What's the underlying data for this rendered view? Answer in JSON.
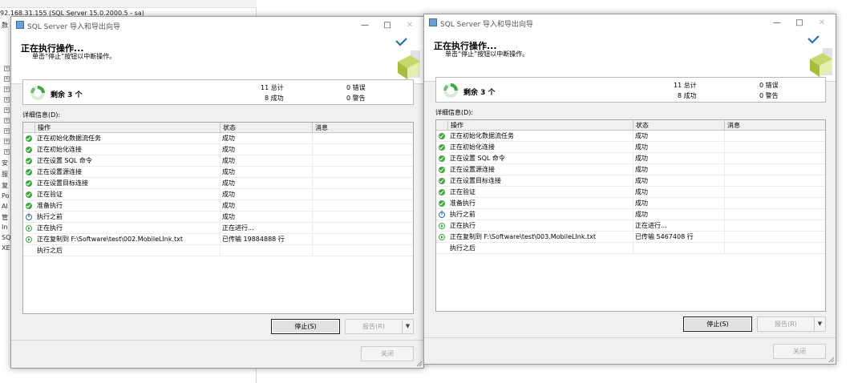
{
  "background": {
    "connection_text": "92.168.31.155 (SQL Server 15.0.2000.5 - sa)",
    "tree_labels": [
      "数",
      "安",
      "服",
      "复",
      "Po",
      "Al",
      "管",
      "In",
      "SQ",
      "XE"
    ]
  },
  "dialogs": [
    {
      "title": "SQL Server 导入和导出向导",
      "header_title": "正在执行操作...",
      "header_subtitle": "单击“停止”按钮以中断操作。",
      "remaining": "剩余 3 个",
      "stats": {
        "total": "11 总计",
        "success": "8 成功",
        "errors": "0 错误",
        "warnings": "0 警告"
      },
      "details_label": "详细信息(D):",
      "columns": {
        "action": "操作",
        "status": "状态",
        "message": "消息"
      },
      "rows": [
        {
          "icon": "ok",
          "action": "正在初始化数据流任务",
          "status": "成功"
        },
        {
          "icon": "ok",
          "action": "正在初始化连接",
          "status": "成功"
        },
        {
          "icon": "ok",
          "action": "正在设置 SQL 命令",
          "status": "成功"
        },
        {
          "icon": "ok",
          "action": "正在设置源连接",
          "status": "成功"
        },
        {
          "icon": "ok",
          "action": "正在设置目标连接",
          "status": "成功"
        },
        {
          "icon": "ok",
          "action": "正在验证",
          "status": "成功"
        },
        {
          "icon": "ok",
          "action": "准备执行",
          "status": "成功"
        },
        {
          "icon": "info",
          "action": "执行之前",
          "status": "成功"
        },
        {
          "icon": "run",
          "action": "正在执行",
          "status": "正在进行..."
        },
        {
          "icon": "run",
          "action": "正在复制到 F:\\Software\\test\\002.MobileLInk.txt",
          "status": "已传输 19884888 行"
        },
        {
          "icon": "",
          "action": "执行之后",
          "status": ""
        }
      ],
      "stop_label": "停止(S)",
      "report_label": "报告(R)",
      "close_label": "关闭"
    },
    {
      "title": "SQL Server 导入和导出向导",
      "header_title": "正在执行操作...",
      "header_subtitle": "单击“停止”按钮以中断操作。",
      "remaining": "剩余 3 个",
      "stats": {
        "total": "11 总计",
        "success": "8 成功",
        "errors": "0 错误",
        "warnings": "0 警告"
      },
      "details_label": "详细信息(D):",
      "columns": {
        "action": "操作",
        "status": "状态",
        "message": "消息"
      },
      "rows": [
        {
          "icon": "ok",
          "action": "正在初始化数据流任务",
          "status": "成功"
        },
        {
          "icon": "ok",
          "action": "正在初始化连接",
          "status": "成功"
        },
        {
          "icon": "ok",
          "action": "正在设置 SQL 命令",
          "status": "成功"
        },
        {
          "icon": "ok",
          "action": "正在设置源连接",
          "status": "成功"
        },
        {
          "icon": "ok",
          "action": "正在设置目标连接",
          "status": "成功"
        },
        {
          "icon": "ok",
          "action": "正在验证",
          "status": "成功"
        },
        {
          "icon": "ok",
          "action": "准备执行",
          "status": "成功"
        },
        {
          "icon": "info",
          "action": "执行之前",
          "status": "成功"
        },
        {
          "icon": "run",
          "action": "正在执行",
          "status": "正在进行..."
        },
        {
          "icon": "run",
          "action": "正在复制到 F:\\Software\\test\\003.MobileLInk.txt",
          "status": "已传输 5467408 行"
        },
        {
          "icon": "",
          "action": "执行之后",
          "status": ""
        }
      ],
      "stop_label": "停止(S)",
      "report_label": "报告(R)",
      "close_label": "关闭"
    }
  ]
}
